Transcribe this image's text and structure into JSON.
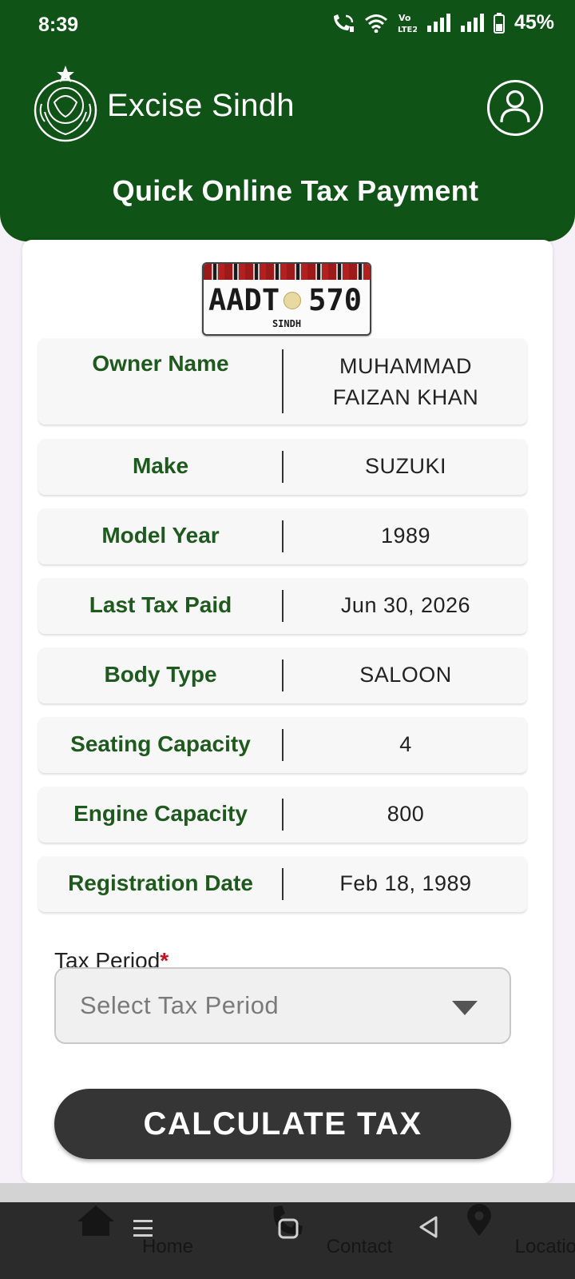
{
  "status_bar": {
    "time": "8:39",
    "battery": "45%",
    "icons": [
      "wifi-call-icon",
      "wifi-icon",
      "volte-icon",
      "signal-icon",
      "signal-icon",
      "battery-icon"
    ]
  },
  "header": {
    "app_title": "Excise Sindh",
    "subtitle": "Quick Online Tax Payment",
    "logo": "sindh-emblem-logo",
    "profile_icon": "user-icon"
  },
  "plate": {
    "letters": "AADT",
    "number": "570",
    "region": "SINDH"
  },
  "vehicle_details": [
    {
      "label": "Owner Name",
      "value": "MUHAMMAD FAIZAN KHAN"
    },
    {
      "label": "Make",
      "value": "SUZUKI"
    },
    {
      "label": "Model Year",
      "value": "1989"
    },
    {
      "label": "Last Tax Paid",
      "value": "Jun 30, 2026"
    },
    {
      "label": "Body Type",
      "value": "SALOON"
    },
    {
      "label": "Seating Capacity",
      "value": "4"
    },
    {
      "label": "Engine Capacity",
      "value": "800"
    },
    {
      "label": "Registration Date",
      "value": "Feb 18, 1989"
    }
  ],
  "tax_period": {
    "label": "Tax Period",
    "required_mark": "*",
    "placeholder": "Select Tax Period"
  },
  "actions": {
    "calculate_label": "CALCULATE TAX"
  },
  "bottom_nav": {
    "items": [
      {
        "label": "Home",
        "icon": "home-icon"
      },
      {
        "label": "Contact",
        "icon": "phone-icon"
      },
      {
        "label": "Location",
        "icon": "location-pin-icon"
      }
    ]
  },
  "colors": {
    "brand_green": "#0f5316",
    "label_green": "#1e5a1e",
    "button_dark": "#353535",
    "required_red": "#c1121f"
  }
}
